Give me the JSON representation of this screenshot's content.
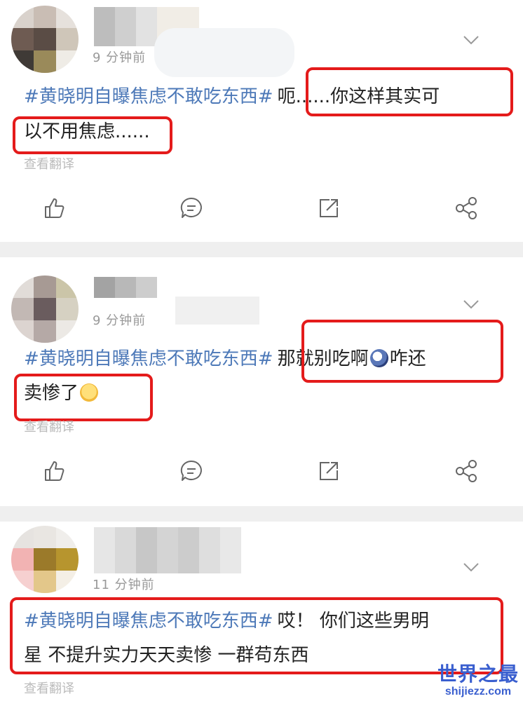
{
  "posts": [
    {
      "time": "9 分钟前",
      "hashtag": "#黄晓明自曝焦虑不敢吃东西#",
      "text_line1_after_tag": "呃......你这样其实可",
      "text_line2": "以不用焦虑......",
      "translate_label": "查看翻译"
    },
    {
      "time": "9 分钟前",
      "hashtag": "#黄晓明自曝焦虑不敢吃东西#",
      "text_line1_part1": "那就别吃啊",
      "text_line1_part2": "咋还",
      "text_line2": "卖惨了",
      "translate_label": "查看翻译"
    },
    {
      "time": "11 分钟前",
      "hashtag": "#黄晓明自曝焦虑不敢吃东西#",
      "text_line1_after_tag": "哎！ 你们这些男明",
      "text_line2": "星 不提升实力天天卖惨 一群苟东西",
      "translate_label": "查看翻译"
    }
  ],
  "icons": {
    "like": "thumbs-up-icon",
    "comment": "comment-icon",
    "repost": "repost-icon",
    "share": "share-icon",
    "more": "chevron-down-icon"
  },
  "colors": {
    "hashtag": "#4d79b8",
    "highlight_box": "#e41b1b",
    "watermark": "#3a5fcf"
  },
  "watermark": {
    "title": "世界之最",
    "url": "shijiezz.com"
  }
}
